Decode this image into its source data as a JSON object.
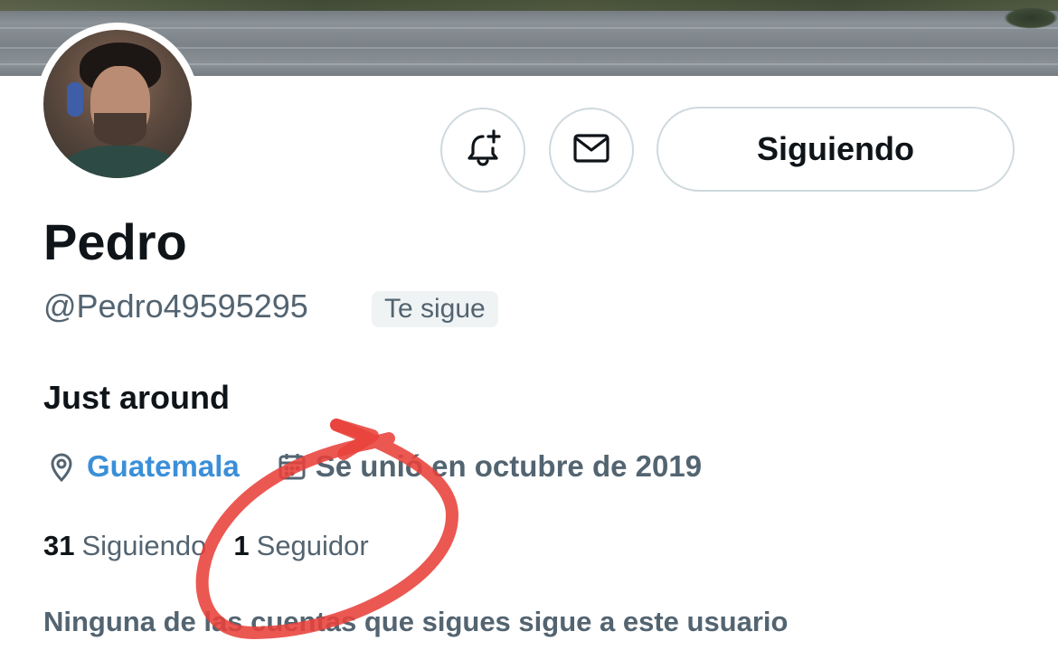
{
  "profile": {
    "name": "Pedro",
    "handle": "@Pedro49595295",
    "follows_you_badge": "Te sigue",
    "bio": "Just around",
    "location": "Guatemala",
    "joined": "Se unió en octubre de 2019",
    "following_count": "31",
    "following_label": "Siguiendo",
    "followers_count": "1",
    "followers_label": "Seguidor",
    "mutual_note": "Ninguna de las cuentas que sigues sigue a este usuario"
  },
  "actions": {
    "follow_button_label": "Siguiendo",
    "notify_icon": "bell-plus-icon",
    "message_icon": "envelope-icon"
  },
  "colors": {
    "text_primary": "#0f1419",
    "text_secondary": "#536471",
    "link": "#3b8fd8",
    "border": "#cfd9de",
    "annotation_red": "#e8413a"
  }
}
